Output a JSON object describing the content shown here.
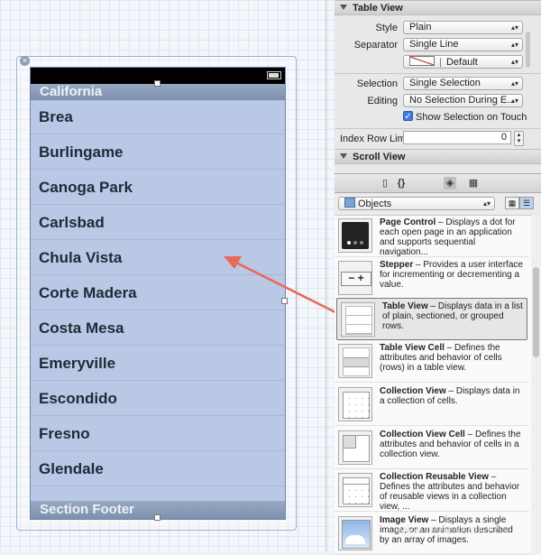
{
  "storyboard": {
    "section_header": "California",
    "section_footer": "Section Footer",
    "rows": [
      "Brea",
      "Burlingame",
      "Canoga Park",
      "Carlsbad",
      "Chula Vista",
      "Corte Madera",
      "Costa Mesa",
      "Emeryville",
      "Escondido",
      "Fresno",
      "Glendale"
    ],
    "row_fill": "#b9c8e4",
    "close_glyph": "×"
  },
  "inspector": {
    "table_view": {
      "title": "Table View",
      "style_label": "Style",
      "style_value": "Plain",
      "separator_label": "Separator",
      "separator_value": "Single Line",
      "separator_color": "Default",
      "selection_label": "Selection",
      "selection_value": "Single Selection",
      "editing_label": "Editing",
      "editing_value": "No Selection During E...",
      "show_selection_label": "Show Selection on Touch",
      "index_row_limit_label": "Index Row Limit",
      "index_row_limit_value": "0"
    },
    "scroll_view": {
      "title": "Scroll View"
    }
  },
  "library": {
    "filter_value": "Objects",
    "items": [
      {
        "name": "Page Control",
        "desc": " – Displays a dot for each open page in an application and supports sequential navigation...",
        "icon": "page-control-icon"
      },
      {
        "name": "Stepper",
        "desc": " – Provides a user interface for incrementing or decrementing a value.",
        "icon": "stepper-icon"
      },
      {
        "name": "Table View",
        "desc": " – Displays data in a list of plain, sectioned, or grouped rows.",
        "icon": "table-view-icon",
        "selected": true
      },
      {
        "name": "Table View Cell",
        "desc": " – Defines the attributes and behavior of cells (rows) in a table view.",
        "icon": "table-view-cell-icon"
      },
      {
        "name": "Collection View",
        "desc": " – Displays data in a collection of cells.",
        "icon": "collection-view-icon"
      },
      {
        "name": "Collection View Cell",
        "desc": " – Defines the attributes and behavior of cells in a collection view.",
        "icon": "collection-view-cell-icon"
      },
      {
        "name": "Collection Reusable View",
        "desc": " – Defines the attributes and behavior of reusable views in a collection view, ...",
        "icon": "collection-reusable-view-icon"
      },
      {
        "name": "Image View",
        "desc": " – Displays a single image, or an animation described by an array of images.",
        "icon": "image-view-icon"
      }
    ]
  },
  "watermark": "WWW.THAICREATE.COM",
  "colors": {
    "arrow": "#e8685a",
    "selection": "#3d7bdd"
  }
}
